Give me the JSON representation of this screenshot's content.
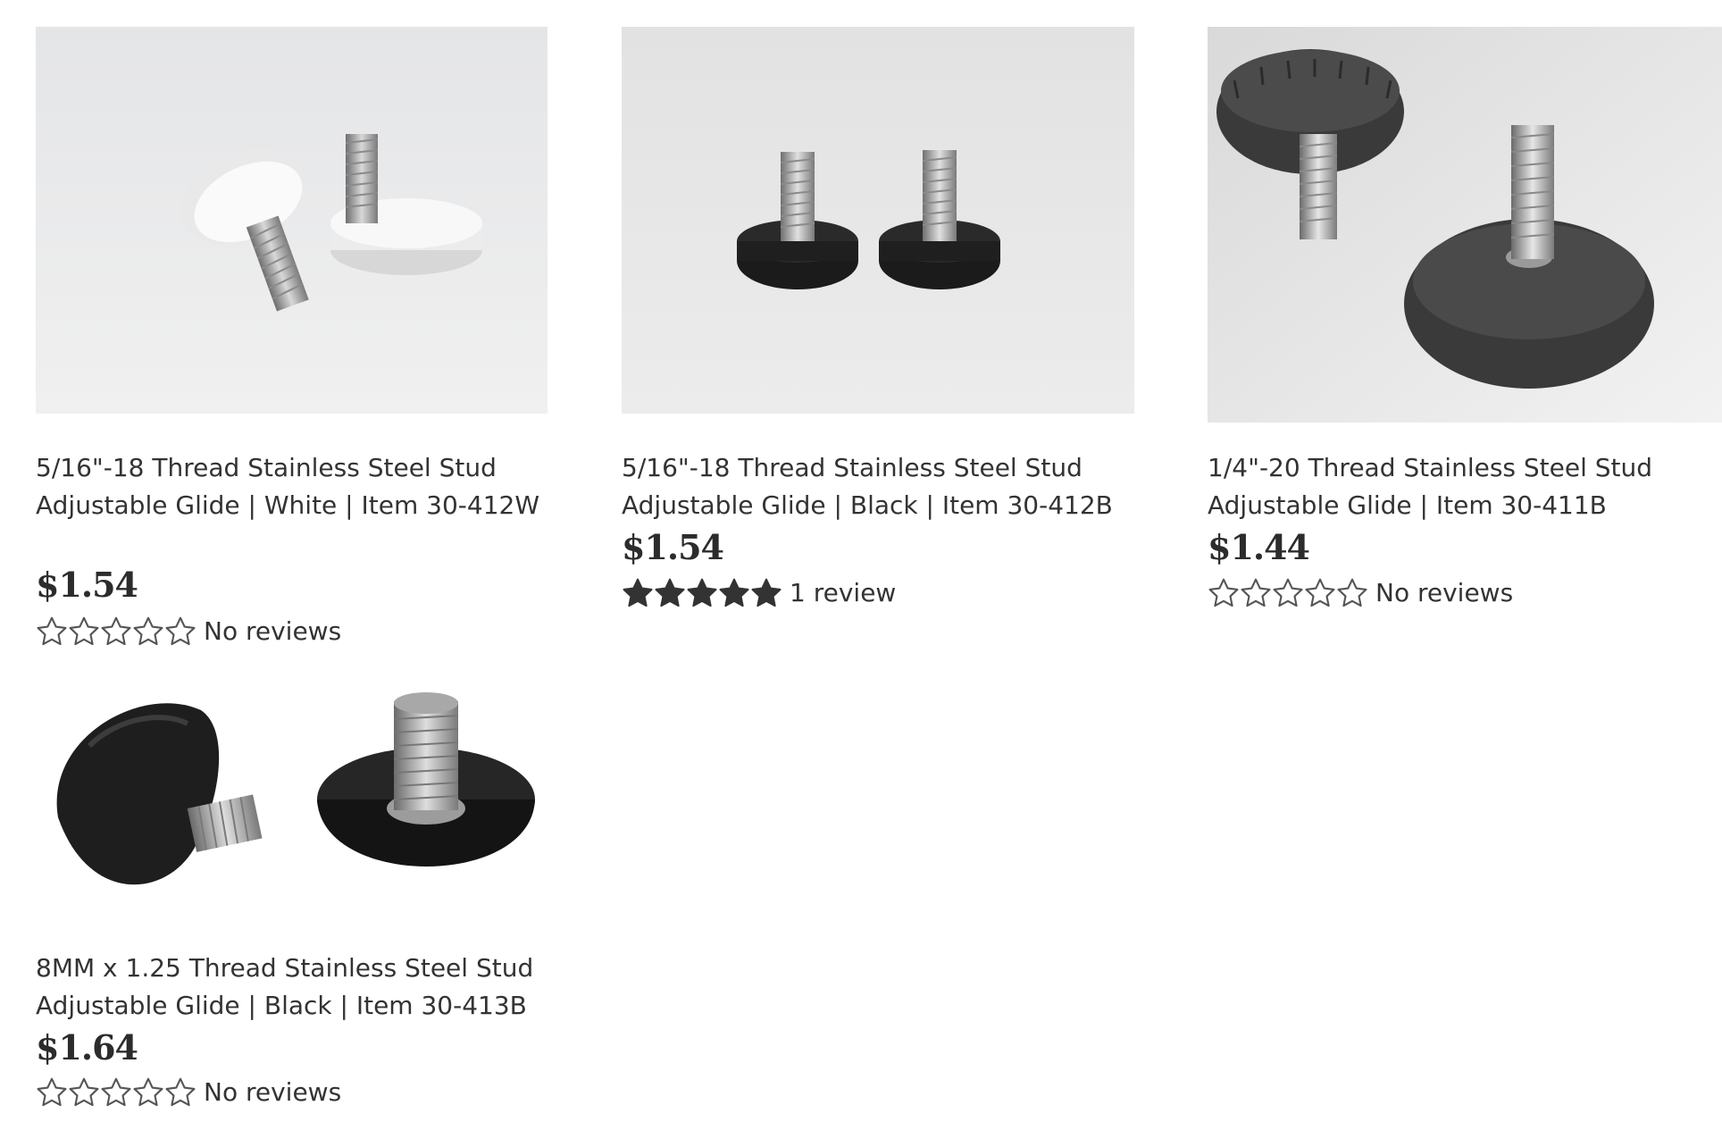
{
  "products": [
    {
      "title": "5/16\"-18 Thread Stainless Steel Stud Adjustable Glide | White | Item 30-412W",
      "price": "$1.54",
      "rating_stars": 0,
      "reviews": "No reviews"
    },
    {
      "title": "5/16\"-18 Thread Stainless Steel Stud Adjustable Glide | Black | Item 30-412B",
      "price": "$1.54",
      "rating_stars": 5,
      "reviews": "1 review"
    },
    {
      "title": "1/4\"-20 Thread Stainless Steel Stud Adjustable Glide | Item 30-411B",
      "price": "$1.44",
      "rating_stars": 0,
      "reviews": "No reviews"
    },
    {
      "title": "8MM x 1.25 Thread Stainless Steel Stud Adjustable Glide | Black | Item 30-413B",
      "price": "$1.64",
      "rating_stars": 0,
      "reviews": "No reviews"
    }
  ],
  "colors": {
    "text": "#333333",
    "price": "#2c2c2c",
    "star_filled": "#333333",
    "star_empty_stroke": "#555555"
  },
  "icons": {
    "star_filled": "star-filled-icon",
    "star_empty": "star-outline-icon"
  }
}
